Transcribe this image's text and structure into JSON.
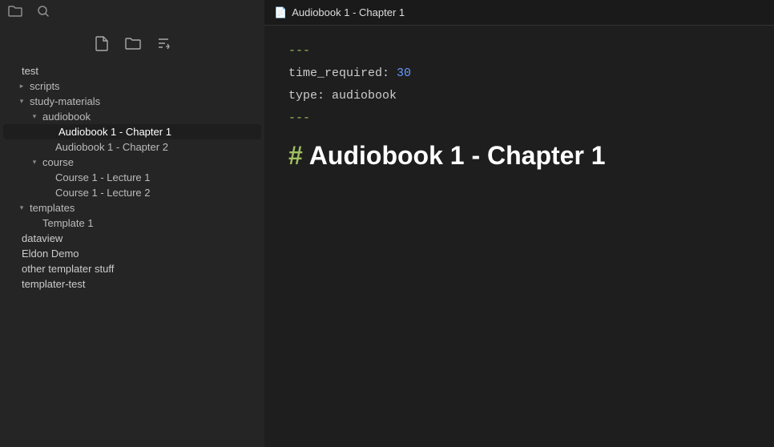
{
  "topbar": {
    "tab_title": "Audiobook 1 - Chapter 1",
    "tab_icon": "📄"
  },
  "sidebar": {
    "toolbar": {
      "new_file_icon": "🗋",
      "new_folder_icon": "🗁",
      "sort_icon": "⇅"
    },
    "tree": [
      {
        "id": "root",
        "label": "test",
        "indent": "indent-0",
        "arrow": "none",
        "type": "root"
      },
      {
        "id": "scripts",
        "label": "scripts",
        "indent": "indent-1",
        "arrow": "collapsed",
        "type": "folder"
      },
      {
        "id": "study-materials",
        "label": "study-materials",
        "indent": "indent-1",
        "arrow": "expanded",
        "type": "folder"
      },
      {
        "id": "audiobook",
        "label": "audiobook",
        "indent": "indent-2",
        "arrow": "expanded",
        "type": "folder"
      },
      {
        "id": "ch1",
        "label": "Audiobook 1 - Chapter 1",
        "indent": "indent-3",
        "arrow": "none",
        "type": "file",
        "active": true
      },
      {
        "id": "ch2",
        "label": "Audiobook 1 - Chapter 2",
        "indent": "indent-3",
        "arrow": "none",
        "type": "file"
      },
      {
        "id": "course",
        "label": "course",
        "indent": "indent-2",
        "arrow": "expanded",
        "type": "folder"
      },
      {
        "id": "lec1",
        "label": "Course 1 - Lecture 1",
        "indent": "indent-3",
        "arrow": "none",
        "type": "file"
      },
      {
        "id": "lec2",
        "label": "Course 1 - Lecture 2",
        "indent": "indent-3",
        "arrow": "none",
        "type": "file"
      },
      {
        "id": "templates",
        "label": "templates",
        "indent": "indent-1",
        "arrow": "expanded",
        "type": "folder"
      },
      {
        "id": "template1",
        "label": "Template 1",
        "indent": "indent-2",
        "arrow": "none",
        "type": "file"
      },
      {
        "id": "dataview",
        "label": "dataview",
        "indent": "indent-0",
        "arrow": "none",
        "type": "root"
      },
      {
        "id": "eldon-demo",
        "label": "Eldon Demo",
        "indent": "indent-0",
        "arrow": "none",
        "type": "root"
      },
      {
        "id": "other-templater",
        "label": "other templater stuff",
        "indent": "indent-0",
        "arrow": "none",
        "type": "root"
      },
      {
        "id": "templater-test",
        "label": "templater-test",
        "indent": "indent-0",
        "arrow": "none",
        "type": "root"
      }
    ]
  },
  "editor": {
    "frontmatter_open": "---",
    "frontmatter_key1": "time_required:",
    "frontmatter_val1": "30",
    "frontmatter_key2": "type:",
    "frontmatter_val2": "audiobook",
    "frontmatter_close": "---",
    "heading_hash": "#",
    "heading_text": "Audiobook 1 - Chapter 1"
  }
}
